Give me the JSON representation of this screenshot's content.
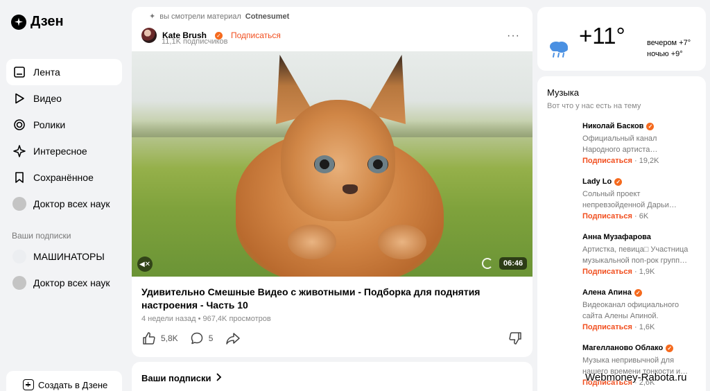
{
  "app": {
    "logo_text": "Дзен"
  },
  "sidebar": {
    "items": [
      {
        "label": "Лента",
        "icon": "feed-icon",
        "active": true
      },
      {
        "label": "Видео",
        "icon": "play-icon"
      },
      {
        "label": "Ролики",
        "icon": "shorts-icon"
      },
      {
        "label": "Интересное",
        "icon": "sparkle-icon"
      },
      {
        "label": "Сохранённое",
        "icon": "bookmark-icon"
      },
      {
        "label": "Доктор всех наук",
        "icon": "avatar"
      }
    ],
    "subscriptions_label": "Ваши подписки",
    "subscriptions": [
      {
        "label": "МАШИНАТОРЫ"
      },
      {
        "label": "Доктор всех наук"
      }
    ],
    "create_label": "Создать в Дзене"
  },
  "post": {
    "watched_prefix": "вы смотрели материал",
    "watched_source": "Cotnesumet",
    "author": "Kate Brush",
    "subscribe": "Подписаться",
    "followers": "11,1K подписчиков",
    "duration": "06:46",
    "title": "Удивительно Смешные Видео с животными - Подборка для поднятия настроения - Часть 10",
    "meta": "4 недели назад • 967,4K просмотров",
    "likes": "5,8K",
    "comments": "5"
  },
  "subscriptions_card": {
    "title": "Ваши подписки"
  },
  "weather": {
    "temp": "+11°",
    "evening": "вечером +7°",
    "night": "ночью +9°"
  },
  "music": {
    "title": "Музыка",
    "subtitle": "Вот что у нас есть на тему",
    "artists": [
      {
        "name": "Николай Басков",
        "desc": "Официальный канал Народного артиста…",
        "subscribe": "Подписаться",
        "count": "19,2K"
      },
      {
        "name": "Lady Lo",
        "desc": "Сольный проект непревзойденной Дарьи…",
        "subscribe": "Подписаться",
        "count": "6K"
      },
      {
        "name": "Анна Музафарова",
        "desc": "Артистка, певица□ Участница музыкальной поп-рок групп…",
        "subscribe": "Подписаться",
        "count": "1,9K"
      },
      {
        "name": "Алена Апина",
        "desc": "Видеоканал официального сайта Алены Апиной.",
        "subscribe": "Подписаться",
        "count": "1,6K"
      },
      {
        "name": "Магелланово Облако",
        "desc": "Музыка непривычной для нашего времени тонкости и…",
        "subscribe": "Подписаться",
        "count": "2,6K"
      }
    ]
  },
  "watermark": "Webmoney-Rabota.ru",
  "colors": {
    "accent": "#f14e1e",
    "verified": "#f56a1e",
    "bg": "#f2f3f5"
  }
}
